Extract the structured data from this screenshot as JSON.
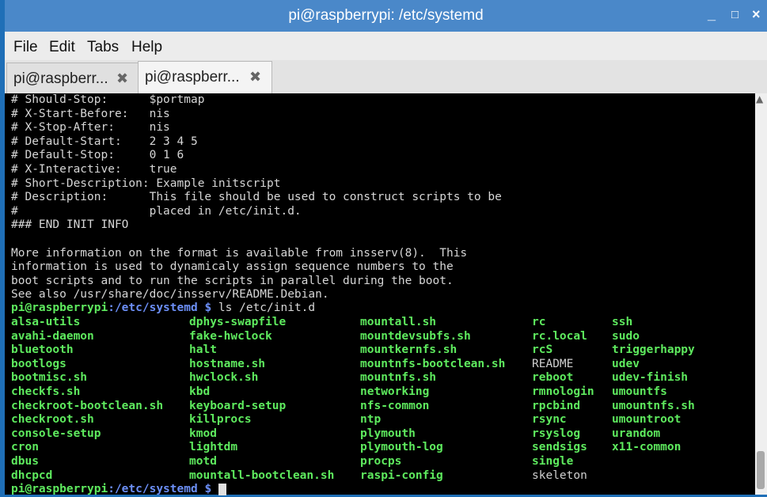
{
  "window": {
    "title": "pi@raspberrypi: /etc/systemd",
    "min_icon": "_",
    "max_icon": "□",
    "close_icon": "×"
  },
  "menu": [
    "File",
    "Edit",
    "Tabs",
    "Help"
  ],
  "tabs": [
    {
      "label": "pi@raspberr...",
      "close": "✖"
    },
    {
      "label": "pi@raspberr...",
      "close": "✖"
    }
  ],
  "terminal": {
    "header_lines": [
      "# Should-Stop:      $portmap",
      "# X-Start-Before:   nis",
      "# X-Stop-After:     nis",
      "# Default-Start:    2 3 4 5",
      "# Default-Stop:     0 1 6",
      "# X-Interactive:    true",
      "# Short-Description: Example initscript",
      "# Description:      This file should be used to construct scripts to be",
      "#                   placed in /etc/init.d.",
      "### END INIT INFO",
      "",
      "More information on the format is available from insserv(8).  This",
      "information is used to dynamicaly assign sequence numbers to the",
      "boot scripts and to run the scripts in parallel during the boot.",
      "See also /usr/share/doc/insserv/README.Debian."
    ],
    "prompt1": {
      "user": "pi@raspberrypi",
      "sep": ":",
      "path": "/etc/systemd",
      "tail": " $ ",
      "cmd": "ls /etc/init.d"
    },
    "listing": [
      [
        "alsa-utils",
        "dphys-swapfile",
        "mountall.sh",
        "rc",
        "ssh"
      ],
      [
        "avahi-daemon",
        "fake-hwclock",
        "mountdevsubfs.sh",
        "rc.local",
        "sudo"
      ],
      [
        "bluetooth",
        "halt",
        "mountkernfs.sh",
        "rcS",
        "triggerhappy"
      ],
      [
        "bootlogs",
        "hostname.sh",
        "mountnfs-bootclean.sh",
        "README",
        "udev"
      ],
      [
        "bootmisc.sh",
        "hwclock.sh",
        "mountnfs.sh",
        "reboot",
        "udev-finish"
      ],
      [
        "checkfs.sh",
        "kbd",
        "networking",
        "rmnologin",
        "umountfs"
      ],
      [
        "checkroot-bootclean.sh",
        "keyboard-setup",
        "nfs-common",
        "rpcbind",
        "umountnfs.sh"
      ],
      [
        "checkroot.sh",
        "killprocs",
        "ntp",
        "rsync",
        "umountroot"
      ],
      [
        "console-setup",
        "kmod",
        "plymouth",
        "rsyslog",
        "urandom"
      ],
      [
        "cron",
        "lightdm",
        "plymouth-log",
        "sendsigs",
        "x11-common"
      ],
      [
        "dbus",
        "motd",
        "procps",
        "single",
        ""
      ],
      [
        "dhcpcd",
        "mountall-bootclean.sh",
        "raspi-config",
        "skeleton",
        ""
      ]
    ],
    "plain_files": [
      "README",
      "skeleton"
    ],
    "prompt2": {
      "user": "pi@raspberrypi",
      "sep": ":",
      "path": "/etc/systemd",
      "tail": " $ "
    }
  },
  "colors": {
    "exec_green": "#5eea5e",
    "dir_blue": "#6c8ff7",
    "title_blue": "#4a88c9"
  }
}
